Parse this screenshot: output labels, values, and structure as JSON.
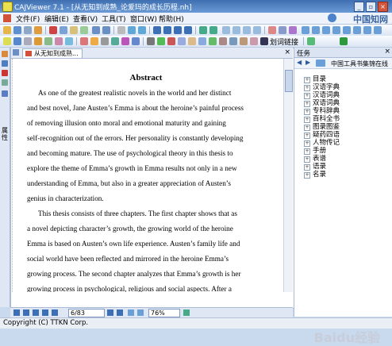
{
  "window": {
    "title": "CAJViewer 7.1 - [从无知到成熟_论爱玛的成长历程.nh]",
    "minimize": "_",
    "restore": "▫",
    "close": "×"
  },
  "menubar": {
    "items": [
      "文件(F)",
      "编辑(E)",
      "查看(V)",
      "工具(T)",
      "窗口(W)",
      "帮助(H)"
    ],
    "brand_logo": "中国知网"
  },
  "toolbar2": {
    "link_label": "划词链接"
  },
  "doc_tab": {
    "label": "从无知到成熟..."
  },
  "left_strip": {
    "vertical_label": "属性"
  },
  "document": {
    "heading": "Abstract",
    "lines": [
      "As one of the greatest realistic novels in the world and her distinct",
      "and best novel, Jane Austen’s Emma is about the heroine’s painful process",
      "of removing illusion onto moral and emotional maturity and gaining",
      "self-recognition out of the errors. Her personality is constantly developing",
      "and becoming mature. The use of psychological theory in this thesis to",
      "explore the theme of Emma’s growth in Emma results not only in a new",
      "understanding of Emma, but also in a greater appreciation of Austen’s",
      "genius in characterization.",
      "This thesis consists of three chapters. The first chapter shows that as",
      "a novel depicting character’s growth, the growing world of the heroine",
      "Emma is based on Austen’s own life experience. Austen’s family life and",
      "social world have been reflected and mirrored in the heroine Emma’s",
      "growing process. The second chapter analyzes that Emma’s growth is her",
      "growing process in psychological, religious and social aspects. After a"
    ]
  },
  "navbar": {
    "page_value": "6/83",
    "zoom_value": "76%"
  },
  "task_pane": {
    "title": "任务",
    "close": "×",
    "source": "中国工具书集锦在线",
    "tree_items": [
      "目录",
      "汉语字典",
      "汉语词典",
      "双语词典",
      "专科辞典",
      "百科全书",
      "图录图鉴",
      "疑药四语",
      "人物传记",
      "手册",
      "表谱",
      "语录",
      "名录"
    ]
  },
  "statusbar": {
    "text": "Copyright (C) TTKN Corp."
  },
  "watermark": "Baidu经验",
  "colors": {
    "titlebar": "#3f6fb0",
    "chrome": "#c9d9ee",
    "accent": "#3a67a3"
  }
}
